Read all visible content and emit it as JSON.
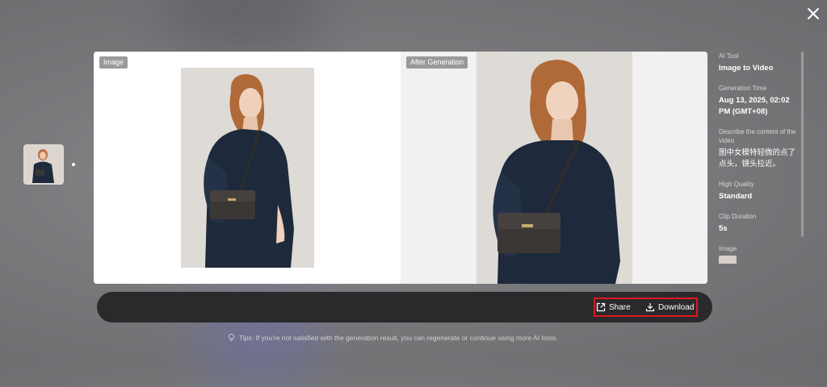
{
  "left_pane": {
    "tag": "Image"
  },
  "right_pane": {
    "tag": "After Generation"
  },
  "info": {
    "ai_tool_label": "AI Tool",
    "ai_tool_value": "Image to Video",
    "generation_time_label": "Generation Time",
    "generation_time_value": "Aug 13, 2025, 02:02 PM (GMT+08)",
    "describe_label": "Describe the content of the video",
    "describe_value": "图中女模特轻微的点了点头，镜头拉近。",
    "quality_label": "High Quality",
    "quality_value": "Standard",
    "duration_label": "Clip Duration",
    "duration_value": "5s",
    "image_label": "Image"
  },
  "actions": {
    "share_label": "Share",
    "download_label": "Download"
  },
  "tips": {
    "text": "Tips: If you're not satisfied with the generation result, you can regenerate or continue using more AI tools."
  },
  "icons": {
    "close": "close-icon",
    "share": "share-icon",
    "download": "download-icon",
    "tip": "lightbulb-icon"
  },
  "colors": {
    "highlight": "#e0171d",
    "action_bar": "#2a2a2c"
  }
}
